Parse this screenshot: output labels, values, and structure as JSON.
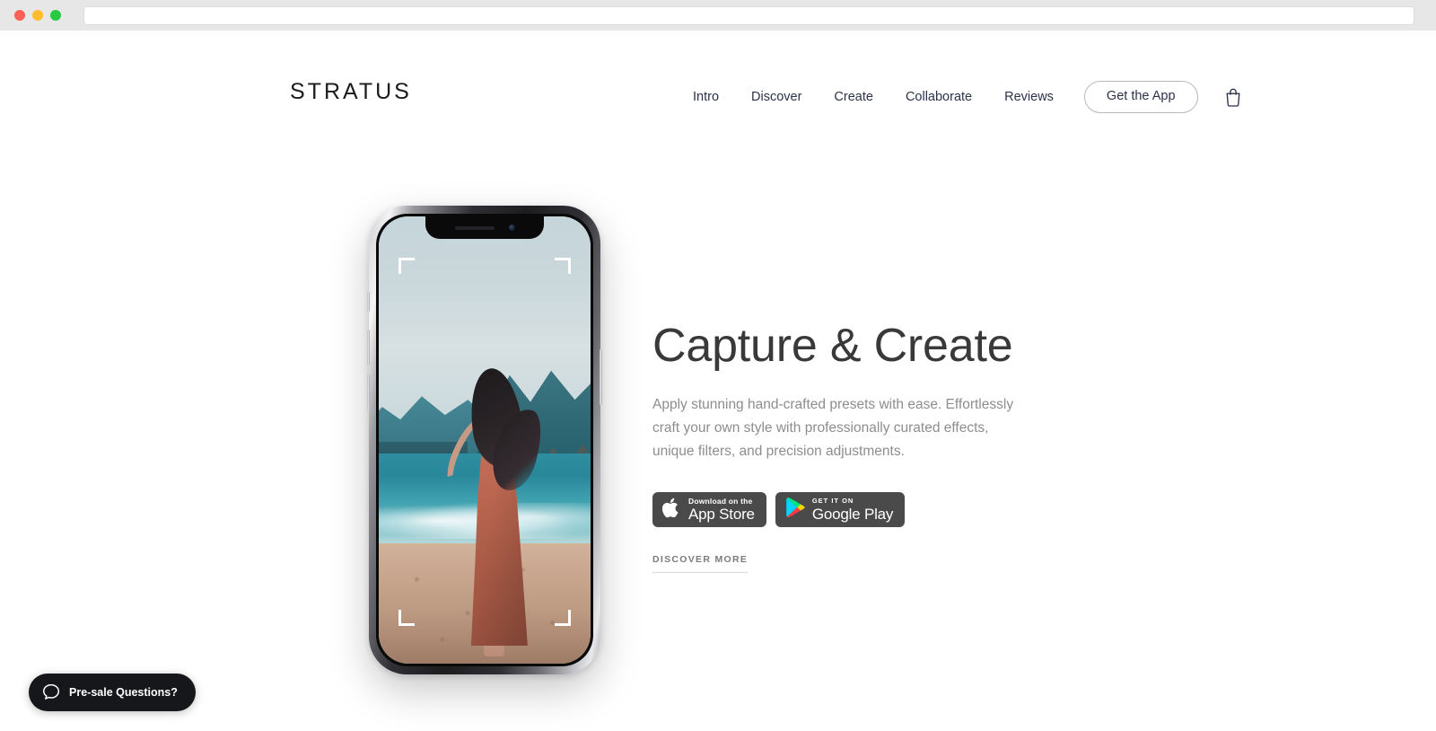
{
  "browser": {
    "url_value": "",
    "url_placeholder": "",
    "traffic_lights": [
      "close",
      "minimize",
      "maximize"
    ],
    "colors": {
      "close": "#ff5f57",
      "minimize": "#ffbd2e",
      "maximize": "#28ca42",
      "chrome": "#e7e7e8"
    }
  },
  "header": {
    "brand": "STRATUS",
    "nav": [
      {
        "label": "Intro"
      },
      {
        "label": "Discover"
      },
      {
        "label": "Create"
      },
      {
        "label": "Collaborate"
      },
      {
        "label": "Reviews"
      }
    ],
    "cta_label": "Get the App",
    "cart_icon": "shopping-bag-icon"
  },
  "hero": {
    "title": "Capture & Create",
    "subtitle": "Apply stunning hand-crafted presets with ease. Effortlessly craft your own style with professionally curated effects, unique filters, and precision adjustments.",
    "badges": [
      {
        "icon": "apple-icon",
        "small": "Download on the",
        "big": "App Store"
      },
      {
        "icon": "google-play-icon",
        "small": "GET IT ON",
        "big": "Google Play"
      }
    ],
    "discover_label": "DISCOVER MORE",
    "device": {
      "name": "iphone-mockup",
      "screen_alt": "Woman in a rust-colored dress on a beach with teal ocean and mountains",
      "overlay": "camera-viewfinder-brackets"
    }
  },
  "help_widget": {
    "label": "Pre-sale Questions?",
    "icon": "chat-bubble-icon",
    "background": "#16171a"
  },
  "theme": {
    "page_background": "#ffffff",
    "text_dark": "#393939",
    "text_muted": "#8d8d8d",
    "nav_text": "#2c3249",
    "badge_background": "#4a4a4a"
  }
}
